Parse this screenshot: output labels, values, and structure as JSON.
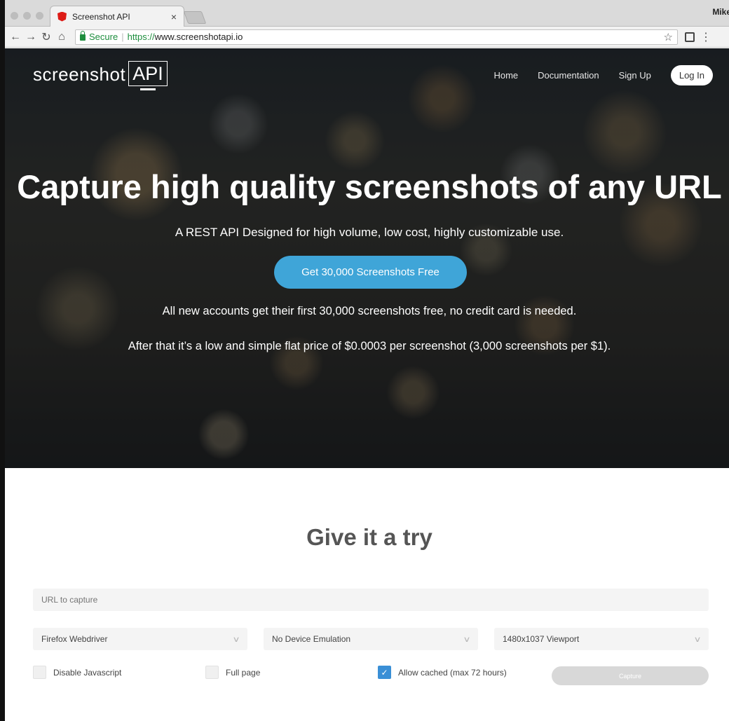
{
  "browser": {
    "tab_title": "Screenshot API",
    "tab_close": "×",
    "profile": "Mike",
    "secure_label": "Secure",
    "url_scheme": "https://",
    "url_host": "www.screenshotapi.io",
    "icons": {
      "back": "back-icon",
      "forward": "forward-icon",
      "reload": "reload-icon",
      "home": "home-icon",
      "bookmark": "star-icon",
      "extension": "extension-icon",
      "menu": "menu-icon"
    }
  },
  "header": {
    "logo_word": "screenshot",
    "logo_box": "API",
    "nav": [
      "Home",
      "Documentation",
      "Sign Up"
    ],
    "login": "Log In"
  },
  "hero": {
    "title": "Capture high quality screenshots of any URL",
    "subtitle": "A REST API Designed for high volume, low cost, highly customizable use.",
    "cta": "Get 30,000 Screenshots Free",
    "p1": "All new accounts get their first 30,000 screenshots free, no credit card is needed.",
    "p2": "After that it’s a low and simple flat price of $0.0003 per screenshot (3,000 screenshots per $1)."
  },
  "try": {
    "title": "Give it a try",
    "url_placeholder": "URL to capture",
    "selects": [
      "Firefox Webdriver",
      "No Device Emulation",
      "1480x1037 Viewport"
    ],
    "options": [
      {
        "label": "Disable Javascript",
        "checked": false
      },
      {
        "label": "Full page",
        "checked": false
      },
      {
        "label": "Allow cached (max 72 hours)",
        "checked": true
      }
    ],
    "capture_label": "Capture"
  }
}
